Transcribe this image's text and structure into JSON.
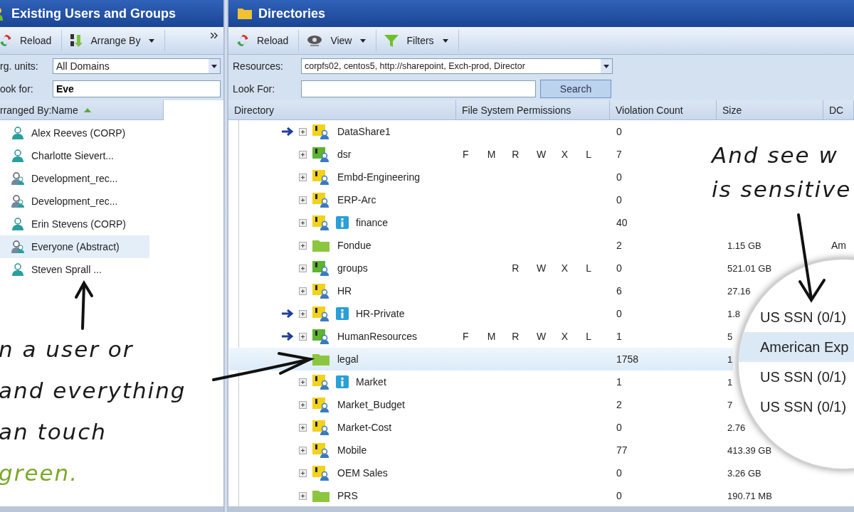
{
  "left_panel": {
    "title": "Existing Users and Groups",
    "toolbar": [
      {
        "kind": "reload",
        "label": "Reload",
        "dropdown": false
      },
      {
        "kind": "arrange",
        "label": "Arrange By",
        "dropdown": true
      }
    ],
    "org_units": {
      "label": "rg. units:",
      "value": "All Domains"
    },
    "look_for": {
      "label": "ook for:",
      "value": "Eve"
    },
    "sort_header": "rranged By:Name",
    "items": [
      {
        "name": "Alex Reeves (CORP)",
        "kind": "user",
        "selected": false
      },
      {
        "name": "Charlotte Sievert...",
        "kind": "user",
        "selected": false
      },
      {
        "name": "Development_rec...",
        "kind": "group",
        "selected": false
      },
      {
        "name": "Development_rec...",
        "kind": "group",
        "selected": false
      },
      {
        "name": "Erin Stevens (CORP)",
        "kind": "user",
        "selected": false
      },
      {
        "name": "Everyone (Abstract)",
        "kind": "group",
        "selected": true
      },
      {
        "name": "Steven Sprall ...",
        "kind": "user",
        "selected": false
      }
    ]
  },
  "annotation_left": [
    {
      "text": "n a user or",
      "color": "#1a1a1a"
    },
    {
      "text": "and everything",
      "color": "#1a1a1a"
    },
    {
      "text": "an touch",
      "color": "#1a1a1a"
    },
    {
      "text": "green.",
      "color": "#7aa82a"
    }
  ],
  "right_panel": {
    "title": "Directories",
    "toolbar": [
      {
        "kind": "reload",
        "label": "Reload",
        "dropdown": false
      },
      {
        "kind": "view",
        "label": "View",
        "dropdown": true
      },
      {
        "kind": "filter",
        "label": "Filters",
        "dropdown": true
      }
    ],
    "resources": {
      "label": "Resources:",
      "value": "corpfs02, centos5, http://sharepoint, Exch-prod, Director"
    },
    "look_for": {
      "label": "Look For:"
    },
    "search_button": "Search",
    "columns": [
      "Directory",
      "File System Permissions",
      "Violation Count",
      "Size",
      "DC"
    ],
    "rows": [
      {
        "name": "DataShare1",
        "arrow": true,
        "expander": true,
        "kind": "share",
        "info": false,
        "violations": "0",
        "selected": false
      },
      {
        "name": "dsr",
        "arrow": false,
        "expander": true,
        "kind": "team",
        "info": false,
        "permissions": [
          "F",
          "M",
          "R",
          "W",
          "X",
          "L"
        ],
        "violations": "7",
        "selected": false
      },
      {
        "name": "Embd-Engineering",
        "arrow": false,
        "expander": true,
        "kind": "share",
        "info": false,
        "violations": "0",
        "selected": false
      },
      {
        "name": "ERP-Arc",
        "arrow": false,
        "expander": true,
        "kind": "share",
        "info": false,
        "violations": "0",
        "selected": false
      },
      {
        "name": "finance",
        "arrow": false,
        "expander": true,
        "kind": "share",
        "info": true,
        "violations": "40",
        "selected": false
      },
      {
        "name": "Fondue",
        "arrow": false,
        "expander": true,
        "kind": "folder",
        "info": false,
        "violations": "2",
        "size": "1.15 GB",
        "dcp": "Am",
        "selected": false
      },
      {
        "name": "groups",
        "arrow": false,
        "expander": true,
        "kind": "team",
        "info": false,
        "permissions": [
          "R",
          "W",
          "X",
          "L"
        ],
        "violations": "0",
        "size": "521.01 GB",
        "selected": false
      },
      {
        "name": "HR",
        "arrow": false,
        "expander": true,
        "kind": "share",
        "info": false,
        "violations": "6",
        "size": "27.16",
        "selected": false
      },
      {
        "name": "HR-Private",
        "arrow": true,
        "expander": true,
        "kind": "share",
        "info": true,
        "violations": "0",
        "size": "1.8",
        "selected": false
      },
      {
        "name": "HumanResources",
        "arrow": true,
        "expander": true,
        "kind": "team",
        "info": false,
        "permissions": [
          "F",
          "M",
          "R",
          "W",
          "X",
          "L"
        ],
        "violations": "1",
        "size": "5",
        "selected": false
      },
      {
        "name": "legal",
        "arrow": false,
        "expander": false,
        "kind": "folder",
        "info": false,
        "violations": "1758",
        "size": "1",
        "selected": true
      },
      {
        "name": "Market",
        "arrow": false,
        "expander": true,
        "kind": "share",
        "info": true,
        "violations": "1",
        "size": "1",
        "selected": false
      },
      {
        "name": "Market_Budget",
        "arrow": false,
        "expander": true,
        "kind": "share",
        "info": false,
        "violations": "2",
        "size": "7",
        "selected": false
      },
      {
        "name": "Market-Cost",
        "arrow": false,
        "expander": true,
        "kind": "share",
        "info": false,
        "violations": "0",
        "size": "2.76",
        "selected": false
      },
      {
        "name": "Mobile",
        "arrow": false,
        "expander": true,
        "kind": "share",
        "info": false,
        "violations": "77",
        "size": "413.39 GB",
        "selected": false
      },
      {
        "name": "OEM Sales",
        "arrow": false,
        "expander": true,
        "kind": "share",
        "info": false,
        "violations": "0",
        "size": "3.26 GB",
        "selected": false
      },
      {
        "name": "PRS",
        "arrow": false,
        "expander": true,
        "kind": "folder",
        "info": false,
        "violations": "0",
        "size": "190.71 MB",
        "selected": false
      }
    ]
  },
  "annotation_right": [
    {
      "text": "And see w",
      "color": "#1a1a1a"
    },
    {
      "text": "is sensitive",
      "color": "#1a1a1a"
    }
  ],
  "magnifier": [
    {
      "text": "US SSN (0/1)",
      "selected": false
    },
    {
      "text": "American Exp",
      "selected": true
    },
    {
      "text": "US SSN (0/1)",
      "selected": false
    },
    {
      "text": "US SSN (0/1)",
      "selected": false
    }
  ]
}
